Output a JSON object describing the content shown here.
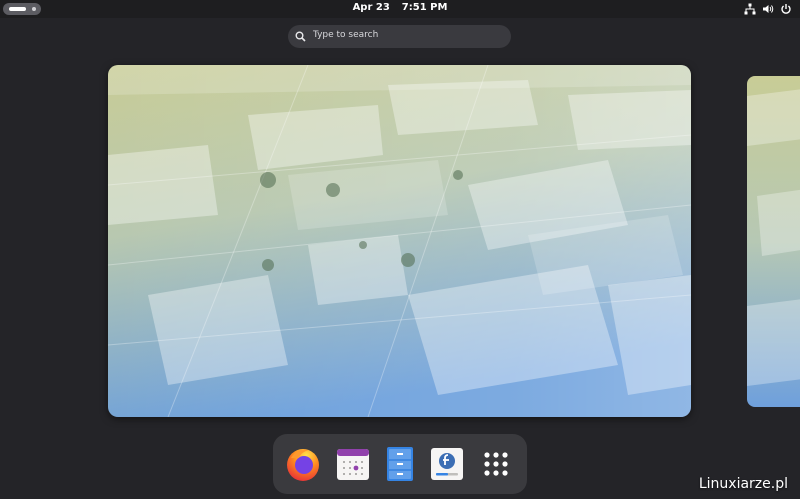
{
  "topbar": {
    "date": "Apr 23",
    "time": "7:51 PM",
    "tray_icons": [
      "network-icon",
      "volume-icon",
      "power-icon"
    ]
  },
  "search": {
    "placeholder": "Type to search"
  },
  "dash": {
    "apps": [
      {
        "name": "Firefox",
        "icon": "firefox-icon"
      },
      {
        "name": "Calendar",
        "icon": "calendar-icon"
      },
      {
        "name": "Files",
        "icon": "files-icon"
      },
      {
        "name": "Software",
        "icon": "software-icon"
      },
      {
        "name": "Show Applications",
        "icon": "app-grid-icon"
      }
    ]
  },
  "watermark": "Linuxiarze.pl",
  "colors": {
    "background": "#242428",
    "topbar": "#1e1e20",
    "search": "#3a3a3f",
    "dash": "#3a3a3e",
    "wallpaper_top": "#c9cf9a",
    "wallpaper_bottom": "#6fa2dc"
  }
}
